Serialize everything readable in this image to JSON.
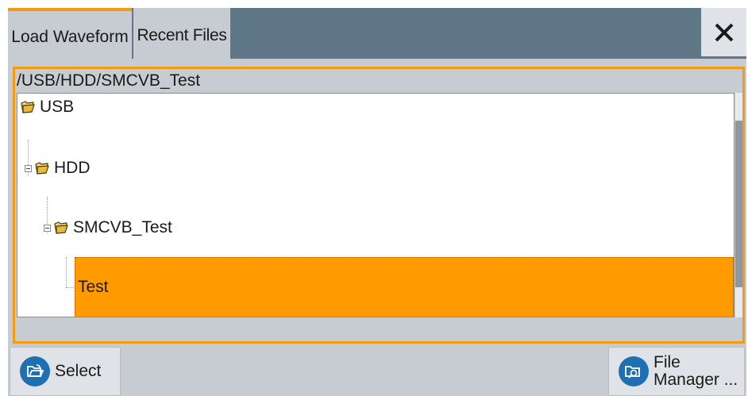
{
  "tabs": [
    {
      "label": "Load Waveform",
      "active": true
    },
    {
      "label": "Recent Files",
      "active": false
    }
  ],
  "close_icon": "close-icon",
  "current_path": "/USB/HDD/SMCVB_Test",
  "tree": {
    "items": [
      {
        "label": "USB",
        "level": 0,
        "icon": "folder-icon"
      },
      {
        "label": "HDD",
        "level": 1,
        "icon": "folder-icon",
        "expanded": true
      },
      {
        "label": "SMCVB_Test",
        "level": 2,
        "icon": "folder-icon",
        "expanded": true
      },
      {
        "label": "Test",
        "level": 3,
        "selected": true
      }
    ]
  },
  "buttons": {
    "select_label": "Select",
    "file_manager_line1": "File",
    "file_manager_line2": "Manager ..."
  },
  "colors": {
    "accent": "#f39c12",
    "selection": "#ff9b00",
    "tabbar": "#5f7787",
    "icon_blue": "#1f6fb2"
  }
}
